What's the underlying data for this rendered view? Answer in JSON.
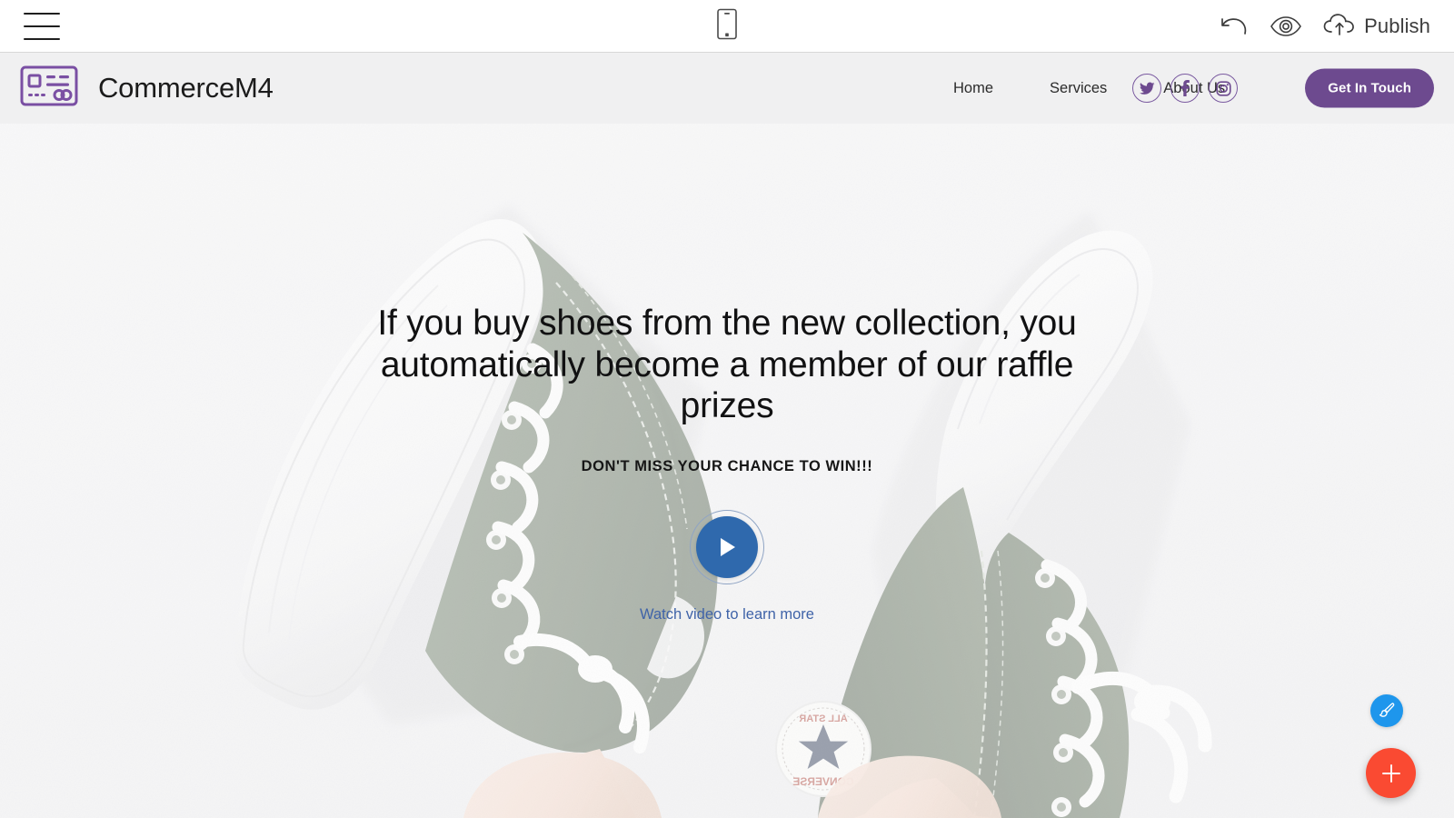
{
  "editor": {
    "menu_icon": "hamburger-menu-icon",
    "device_icon": "mobile-device-icon",
    "undo_icon": "undo-arrow-icon",
    "preview_icon": "eye-preview-icon",
    "publish_icon": "cloud-upload-icon",
    "publish_label": "Publish"
  },
  "site": {
    "brand": {
      "logo_icon": "credit-card-logo-icon",
      "name": "CommerceM4"
    },
    "nav": [
      {
        "label": "Home"
      },
      {
        "label": "Services"
      },
      {
        "label": "About Us"
      }
    ],
    "social": [
      {
        "icon": "twitter-icon",
        "label": "Twitter"
      },
      {
        "icon": "facebook-icon",
        "label": "Facebook"
      },
      {
        "icon": "instagram-icon",
        "label": "Instagram"
      }
    ],
    "cta_label": "Get In Touch"
  },
  "hero": {
    "title": "If you buy shoes from the new collection, you automatically become a member of our raffle prizes",
    "subtitle": "DON'T MISS YOUR CHANCE TO WIN!!!",
    "play_icon": "play-triangle-icon",
    "play_caption": "Watch video to learn more"
  },
  "fabs": {
    "brush": {
      "icon": "paintbrush-icon",
      "label": "Style"
    },
    "add": {
      "icon": "plus-icon",
      "label": "Add block"
    }
  },
  "colors": {
    "brand_purple": "#6d4a8f",
    "play_blue": "#2f69ad",
    "caption_blue": "#3f63a8",
    "fab_blue": "#1e96ec",
    "fab_red": "#fa4a32",
    "header_bg": "#f0f0f1",
    "shoe_green": "#6e7c6a"
  }
}
